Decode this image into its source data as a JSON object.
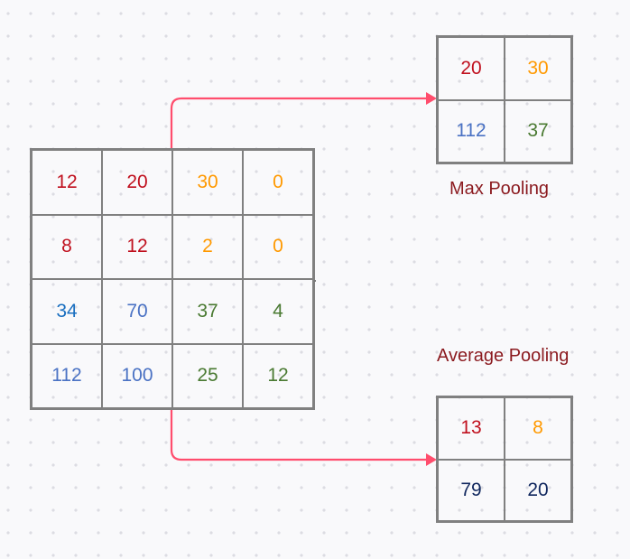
{
  "colors": {
    "red": "#c0101e",
    "orange": "#ff9900",
    "blue": "#1a6fc0",
    "mid_blue": "#4a72c4",
    "green": "#4a7a32",
    "navy": "#10275e",
    "label": "#8b1a1f",
    "arrow": "#ff4d6d",
    "grid_line": "#808080"
  },
  "input_matrix": {
    "rows": [
      [
        {
          "v": "12",
          "c": "red"
        },
        {
          "v": "20",
          "c": "red"
        },
        {
          "v": "30",
          "c": "orange"
        },
        {
          "v": "0",
          "c": "orange"
        }
      ],
      [
        {
          "v": "8",
          "c": "red"
        },
        {
          "v": "12",
          "c": "red"
        },
        {
          "v": "2",
          "c": "orange"
        },
        {
          "v": "0",
          "c": "orange"
        }
      ],
      [
        {
          "v": "34",
          "c": "blue"
        },
        {
          "v": "70",
          "c": "mid_blue"
        },
        {
          "v": "37",
          "c": "green"
        },
        {
          "v": "4",
          "c": "green"
        }
      ],
      [
        {
          "v": "112",
          "c": "mid_blue"
        },
        {
          "v": "100",
          "c": "mid_blue"
        },
        {
          "v": "25",
          "c": "green"
        },
        {
          "v": "12",
          "c": "green"
        }
      ]
    ]
  },
  "max_pooling": {
    "label": "Max Pooling",
    "rows": [
      [
        {
          "v": "20",
          "c": "red"
        },
        {
          "v": "30",
          "c": "orange"
        }
      ],
      [
        {
          "v": "112",
          "c": "mid_blue"
        },
        {
          "v": "37",
          "c": "green"
        }
      ]
    ]
  },
  "average_pooling": {
    "label": "Average Pooling",
    "rows": [
      [
        {
          "v": "13",
          "c": "red"
        },
        {
          "v": "8",
          "c": "orange"
        }
      ],
      [
        {
          "v": "79",
          "c": "navy"
        },
        {
          "v": "20",
          "c": "navy"
        }
      ]
    ]
  },
  "arrows": [
    {
      "from": "input-matrix",
      "to": "max-pooling"
    },
    {
      "from": "input-matrix",
      "to": "average-pooling"
    }
  ]
}
